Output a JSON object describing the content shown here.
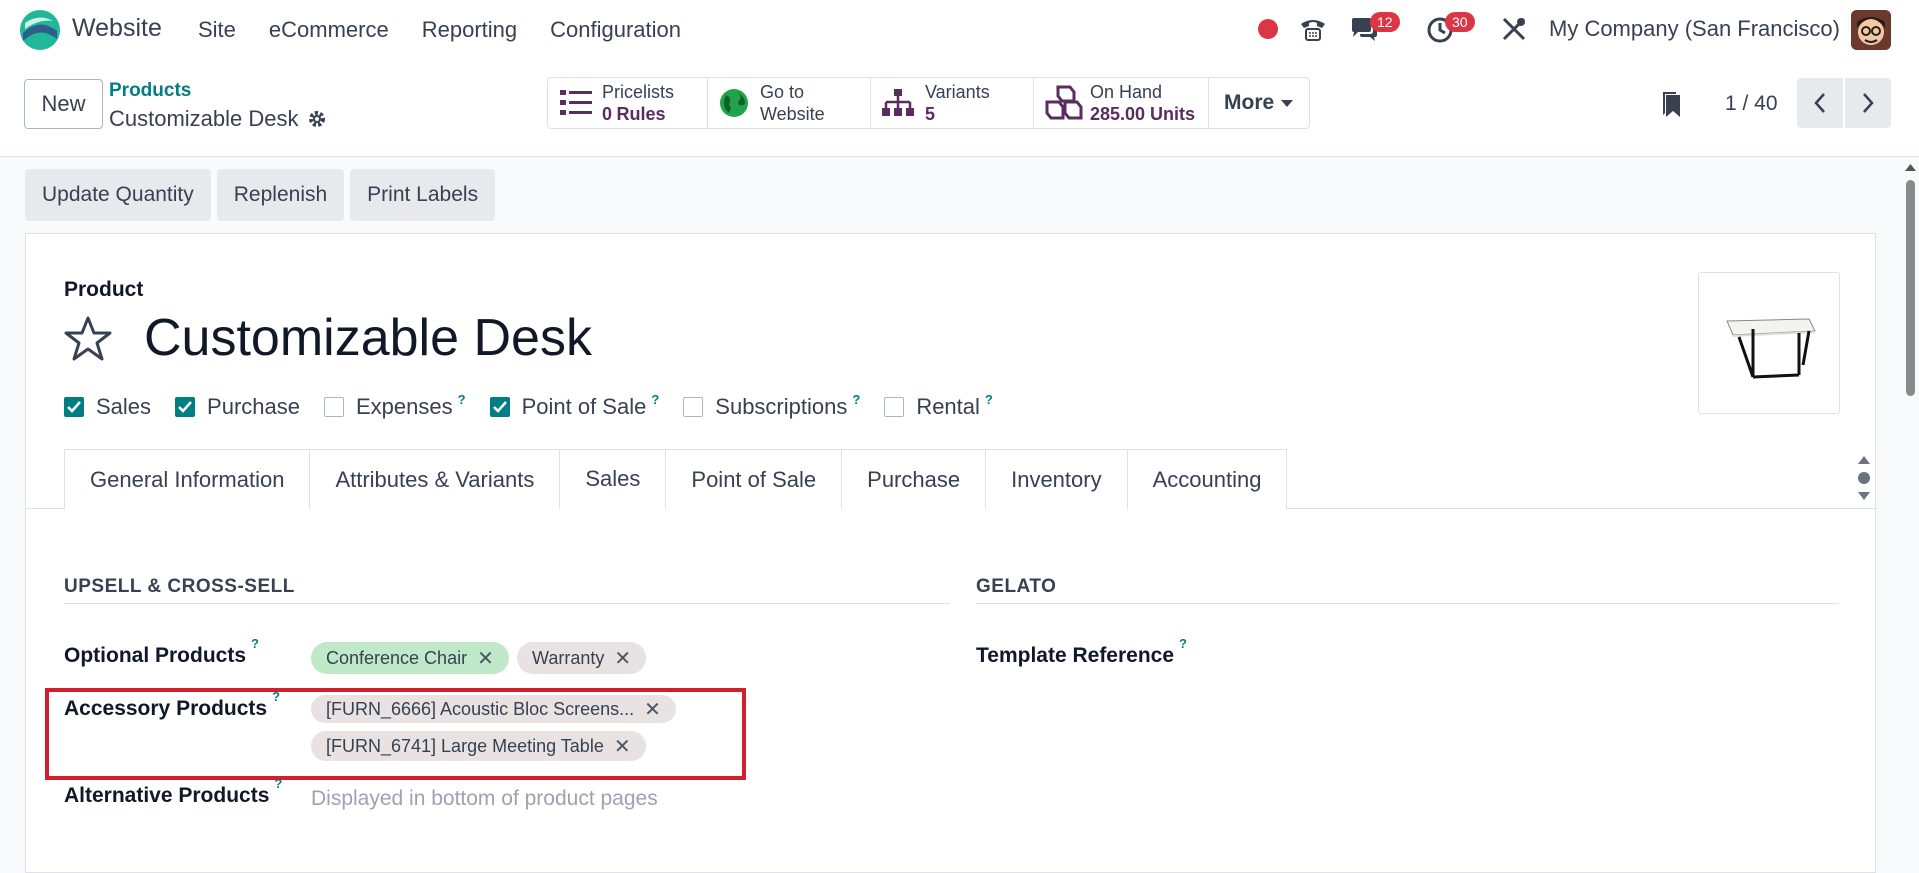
{
  "topbar": {
    "app_name": "Website",
    "menu": [
      "Site",
      "eCommerce",
      "Reporting",
      "Configuration"
    ],
    "messages_count": "12",
    "activities_count": "30",
    "company": "My Company (San Francisco)"
  },
  "control": {
    "new_label": "New",
    "breadcrumb_parent": "Products",
    "breadcrumb_current": "Customizable Desk",
    "stats": {
      "pricelists_label": "Pricelists",
      "pricelists_value": "0",
      "pricelists_unit": "Rules",
      "website_line1": "Go to",
      "website_line2": "Website",
      "variants_label": "Variants",
      "variants_value": "5",
      "onhand_label": "On Hand",
      "onhand_value": "285.00 Units",
      "more_label": "More"
    },
    "pager": "1 / 40"
  },
  "actions": [
    "Update Quantity",
    "Replenish",
    "Print Labels"
  ],
  "product": {
    "label": "Product",
    "name": "Customizable Desk",
    "options": [
      {
        "label": "Sales",
        "checked": true,
        "help": false
      },
      {
        "label": "Purchase",
        "checked": true,
        "help": false
      },
      {
        "label": "Expenses",
        "checked": false,
        "help": true
      },
      {
        "label": "Point of Sale",
        "checked": true,
        "help": true
      },
      {
        "label": "Subscriptions",
        "checked": false,
        "help": true
      },
      {
        "label": "Rental",
        "checked": false,
        "help": true
      }
    ]
  },
  "tabs": [
    "General Information",
    "Attributes & Variants",
    "Sales",
    "Point of Sale",
    "Purchase",
    "Inventory",
    "Accounting"
  ],
  "active_tab": "Sales",
  "sales": {
    "upsell_title": "UPSELL & CROSS-SELL",
    "gelato_title": "GELATO",
    "optional_label": "Optional Products",
    "optional_tags": [
      "Conference Chair",
      "Warranty"
    ],
    "accessory_label": "Accessory Products",
    "accessory_tags": [
      "[FURN_6666] Acoustic Bloc Screens...",
      "[FURN_6741] Large Meeting Table"
    ],
    "alternative_label": "Alternative Products",
    "alternative_placeholder": "Displayed in bottom of product pages",
    "template_label": "Template Reference",
    "help_mark": "?"
  },
  "colors": {
    "accent": "#017e84",
    "brand": "#5b2c5f",
    "badge": "#dc3545",
    "highlight": "#d21f2c"
  }
}
